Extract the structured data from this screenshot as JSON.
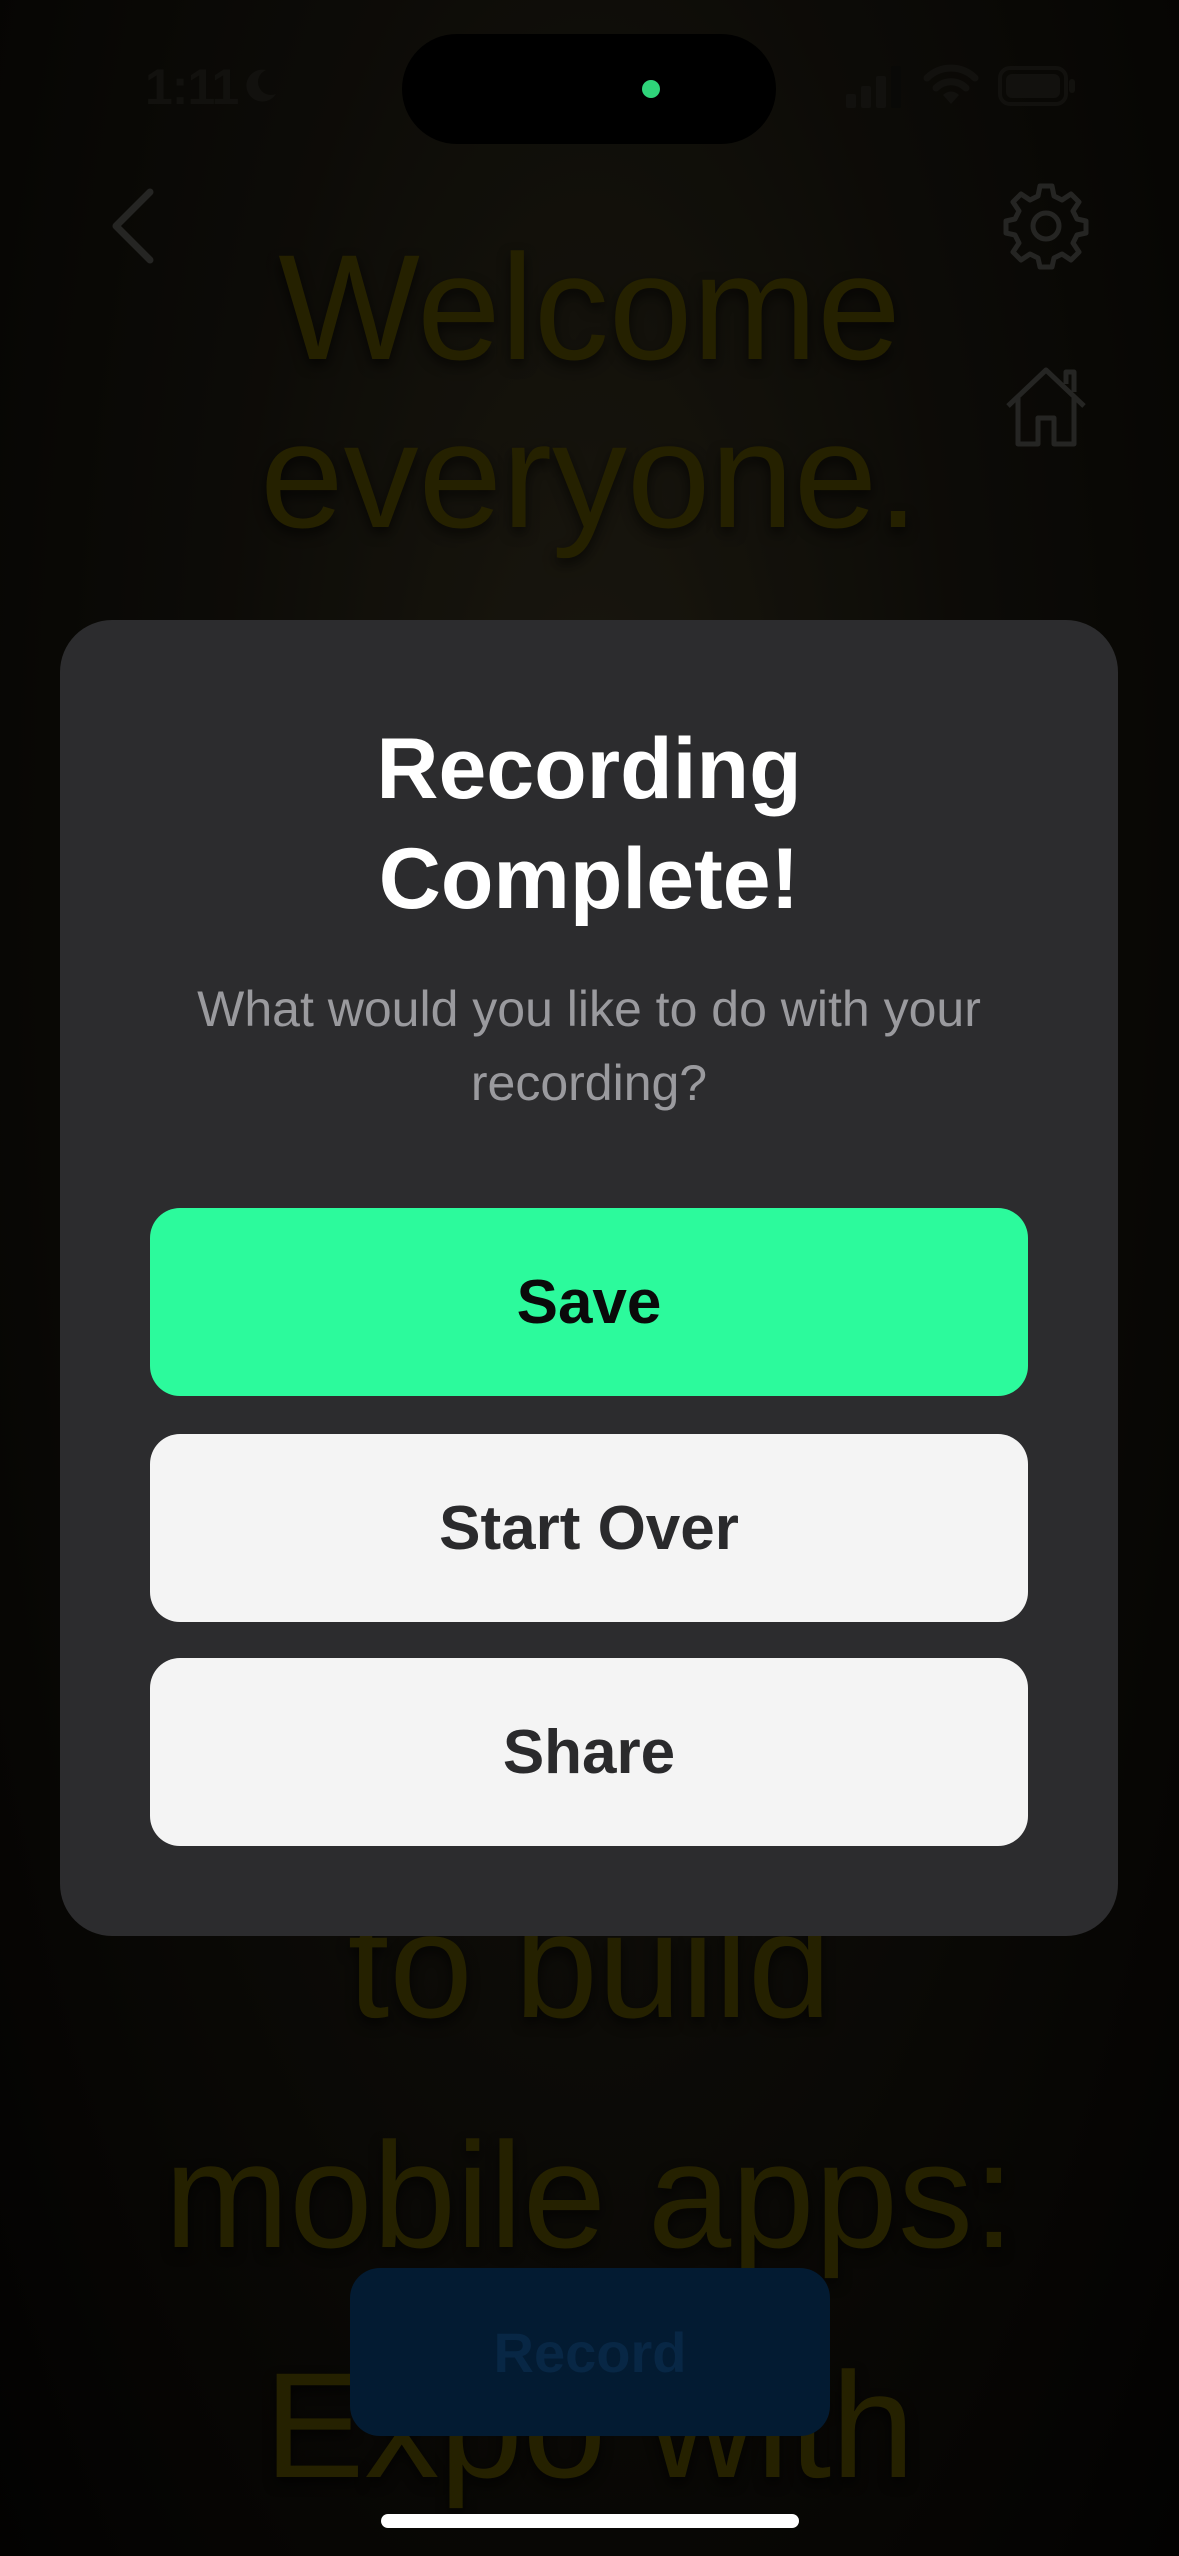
{
  "status_bar": {
    "time": "1:11"
  },
  "background": {
    "lines": [
      "Welcome",
      "everyone.",
      "to build",
      "mobile apps:",
      "Expo with"
    ],
    "record_label": "Record"
  },
  "modal": {
    "title_line1": "Recording",
    "title_line2": "Complete!",
    "subtitle": "What would you like to do with your recording?",
    "buttons": {
      "save": "Save",
      "start_over": "Start Over",
      "share": "Share"
    }
  },
  "colors": {
    "accent_save": "#2cfa9c",
    "modal_bg": "#2c2c2e",
    "secondary_button": "#f4f4f4",
    "background_text": "#3a3300",
    "record_button": "#062a4d"
  },
  "icons": [
    "moon-icon",
    "signal-icon",
    "wifi-icon",
    "battery-icon",
    "back-icon",
    "gear-icon",
    "home-icon"
  ]
}
